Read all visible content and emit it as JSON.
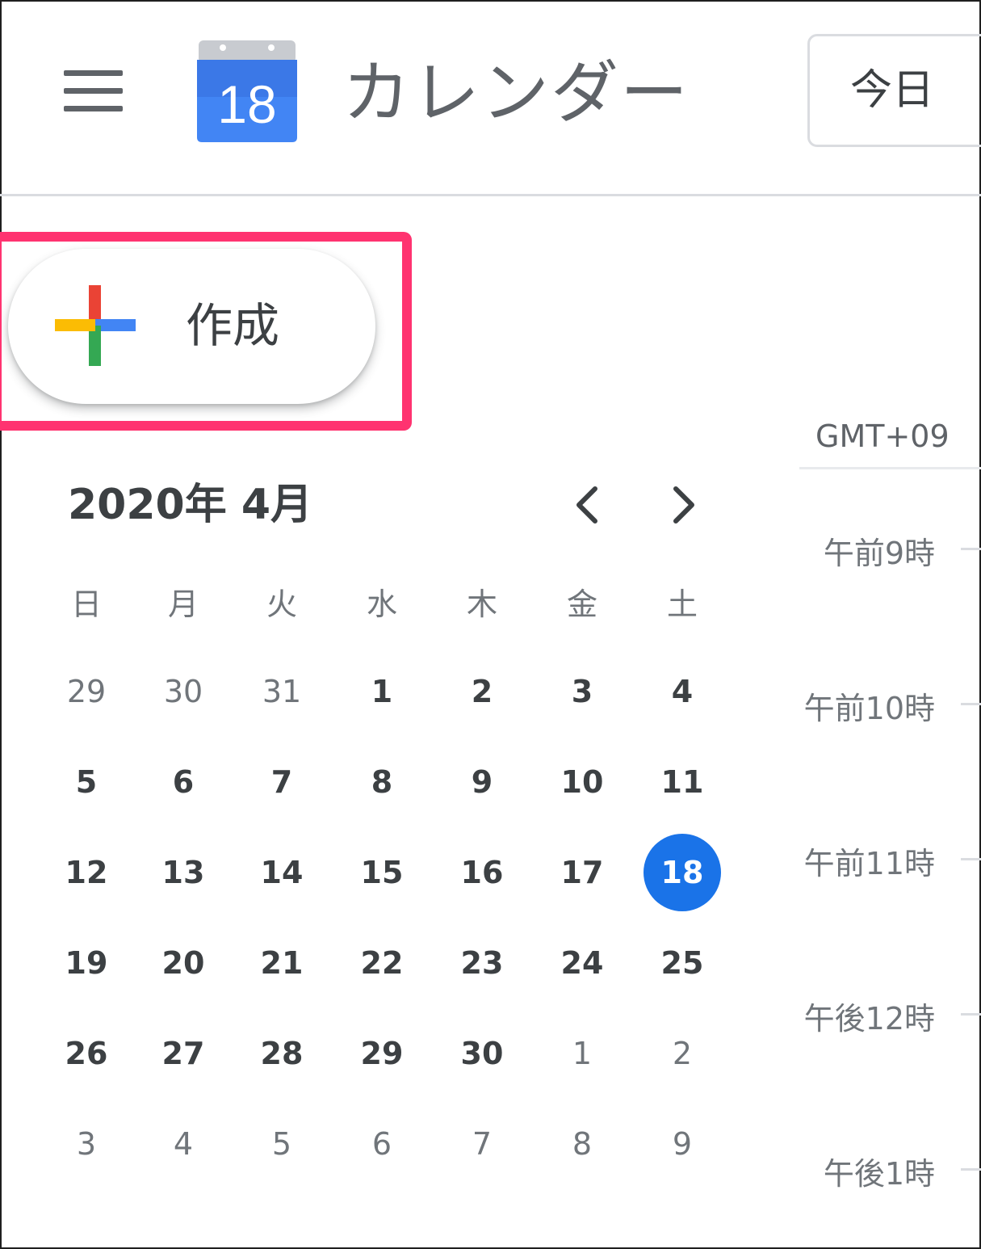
{
  "header": {
    "menu_icon": "hamburger-menu-icon",
    "logo_icon": "google-calendar-logo-icon",
    "logo_day": "18",
    "app_title": "カレンダー",
    "today_label": "今日"
  },
  "create_button": {
    "label": "作成",
    "icon": "multicolor-plus-icon",
    "highlight_color": "#ff3370"
  },
  "mini_calendar": {
    "month_title": "2020年 4月",
    "prev_icon": "chevron-left-icon",
    "next_icon": "chevron-right-icon",
    "weekdays": [
      "日",
      "月",
      "火",
      "水",
      "木",
      "金",
      "土"
    ],
    "weeks": [
      [
        {
          "d": "29",
          "other": true
        },
        {
          "d": "30",
          "other": true
        },
        {
          "d": "31",
          "other": true
        },
        {
          "d": "1"
        },
        {
          "d": "2"
        },
        {
          "d": "3"
        },
        {
          "d": "4"
        }
      ],
      [
        {
          "d": "5"
        },
        {
          "d": "6"
        },
        {
          "d": "7"
        },
        {
          "d": "8"
        },
        {
          "d": "9"
        },
        {
          "d": "10"
        },
        {
          "d": "11"
        }
      ],
      [
        {
          "d": "12"
        },
        {
          "d": "13"
        },
        {
          "d": "14"
        },
        {
          "d": "15"
        },
        {
          "d": "16"
        },
        {
          "d": "17"
        },
        {
          "d": "18",
          "today": true
        }
      ],
      [
        {
          "d": "19"
        },
        {
          "d": "20"
        },
        {
          "d": "21"
        },
        {
          "d": "22"
        },
        {
          "d": "23"
        },
        {
          "d": "24"
        },
        {
          "d": "25"
        }
      ],
      [
        {
          "d": "26"
        },
        {
          "d": "27"
        },
        {
          "d": "28"
        },
        {
          "d": "29"
        },
        {
          "d": "30"
        },
        {
          "d": "1",
          "other": true
        },
        {
          "d": "2",
          "other": true
        }
      ],
      [
        {
          "d": "3",
          "other": true
        },
        {
          "d": "4",
          "other": true
        },
        {
          "d": "5",
          "other": true
        },
        {
          "d": "6",
          "other": true
        },
        {
          "d": "7",
          "other": true
        },
        {
          "d": "8",
          "other": true
        },
        {
          "d": "9",
          "other": true
        }
      ]
    ],
    "today_color": "#1a73e8"
  },
  "timeline": {
    "timezone": "GMT+09",
    "hours": [
      "午前9時",
      "午前10時",
      "午前11時",
      "午後12時",
      "午後1時"
    ]
  }
}
